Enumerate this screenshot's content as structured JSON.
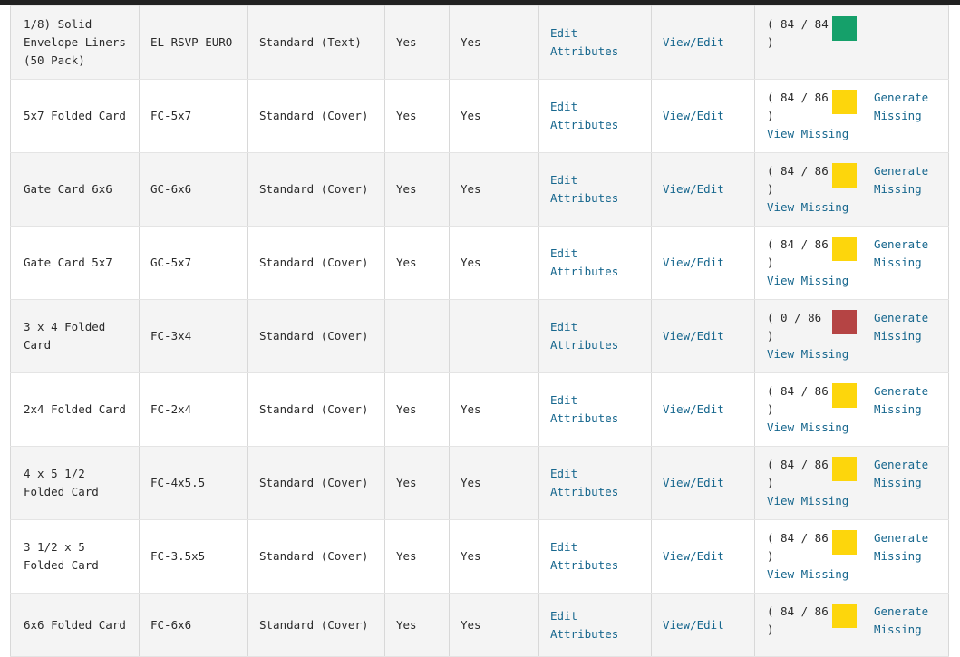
{
  "colors": {
    "topbar": "#212121",
    "link": "#17678e",
    "status_complete": "#15a06a",
    "status_partial": "#fdd60c",
    "status_none": "#b54444",
    "row_odd_bg": "#f4f4f4",
    "row_even_bg": "#ffffff",
    "border": "#d8d8d8"
  },
  "labels": {
    "edit_attributes": "Edit Attributes",
    "view_edit": "View/Edit",
    "generate_missing": "Generate Missing",
    "view_missing": "View Missing"
  },
  "table": {
    "rows": [
      {
        "name": "1/8) Solid Envelope Liners (50 Pack)",
        "sku": "EL-RSVP-EURO",
        "type": "Standard (Text)",
        "col_a": "Yes",
        "col_b": "Yes",
        "edit_attributes": "Edit Attributes",
        "view_edit": "View/Edit",
        "ratio": "( 84 / 84 )",
        "swatch": "status_complete",
        "swatch_color": "#15a06a",
        "generate_missing": "",
        "view_missing": ""
      },
      {
        "name": "5x7 Folded Card",
        "sku": "FC-5x7",
        "type": "Standard (Cover)",
        "col_a": "Yes",
        "col_b": "Yes",
        "edit_attributes": "Edit Attributes",
        "view_edit": "View/Edit",
        "ratio": "( 84 / 86 )",
        "swatch": "status_partial",
        "swatch_color": "#fdd60c",
        "generate_missing": "Generate Missing",
        "view_missing": "View Missing"
      },
      {
        "name": "Gate Card 6x6",
        "sku": "GC-6x6",
        "type": "Standard (Cover)",
        "col_a": "Yes",
        "col_b": "Yes",
        "edit_attributes": "Edit Attributes",
        "view_edit": "View/Edit",
        "ratio": "( 84 / 86 )",
        "swatch": "status_partial",
        "swatch_color": "#fdd60c",
        "generate_missing": "Generate Missing",
        "view_missing": "View Missing"
      },
      {
        "name": "Gate Card 5x7",
        "sku": "GC-5x7",
        "type": "Standard (Cover)",
        "col_a": "Yes",
        "col_b": "Yes",
        "edit_attributes": "Edit Attributes",
        "view_edit": "View/Edit",
        "ratio": "( 84 / 86 )",
        "swatch": "status_partial",
        "swatch_color": "#fdd60c",
        "generate_missing": "Generate Missing",
        "view_missing": "View Missing"
      },
      {
        "name": "3 x 4 Folded Card",
        "sku": "FC-3x4",
        "type": "Standard (Cover)",
        "col_a": "",
        "col_b": "",
        "edit_attributes": "Edit Attributes",
        "view_edit": "View/Edit",
        "ratio": "( 0 / 86 )",
        "swatch": "status_none",
        "swatch_color": "#b54444",
        "generate_missing": "Generate Missing",
        "view_missing": "View Missing"
      },
      {
        "name": "2x4 Folded Card",
        "sku": "FC-2x4",
        "type": "Standard (Cover)",
        "col_a": "Yes",
        "col_b": "Yes",
        "edit_attributes": "Edit Attributes",
        "view_edit": "View/Edit",
        "ratio": "( 84 / 86 )",
        "swatch": "status_partial",
        "swatch_color": "#fdd60c",
        "generate_missing": "Generate Missing",
        "view_missing": "View Missing"
      },
      {
        "name": "4 x 5 1/2 Folded Card",
        "sku": "FC-4x5.5",
        "type": "Standard (Cover)",
        "col_a": "Yes",
        "col_b": "Yes",
        "edit_attributes": "Edit Attributes",
        "view_edit": "View/Edit",
        "ratio": "( 84 / 86 )",
        "swatch": "status_partial",
        "swatch_color": "#fdd60c",
        "generate_missing": "Generate Missing",
        "view_missing": "View Missing"
      },
      {
        "name": "3 1/2 x 5 Folded Card",
        "sku": "FC-3.5x5",
        "type": "Standard (Cover)",
        "col_a": "Yes",
        "col_b": "Yes",
        "edit_attributes": "Edit Attributes",
        "view_edit": "View/Edit",
        "ratio": "( 84 / 86 )",
        "swatch": "status_partial",
        "swatch_color": "#fdd60c",
        "generate_missing": "Generate Missing",
        "view_missing": "View Missing"
      },
      {
        "name": "6x6 Folded Card",
        "sku": "FC-6x6",
        "type": "Standard (Cover)",
        "col_a": "Yes",
        "col_b": "Yes",
        "edit_attributes": "Edit Attributes",
        "view_edit": "View/Edit",
        "ratio": "( 84 / 86 )",
        "swatch": "status_partial",
        "swatch_color": "#fdd60c",
        "generate_missing": "Generate Missing",
        "view_missing": ""
      }
    ]
  }
}
